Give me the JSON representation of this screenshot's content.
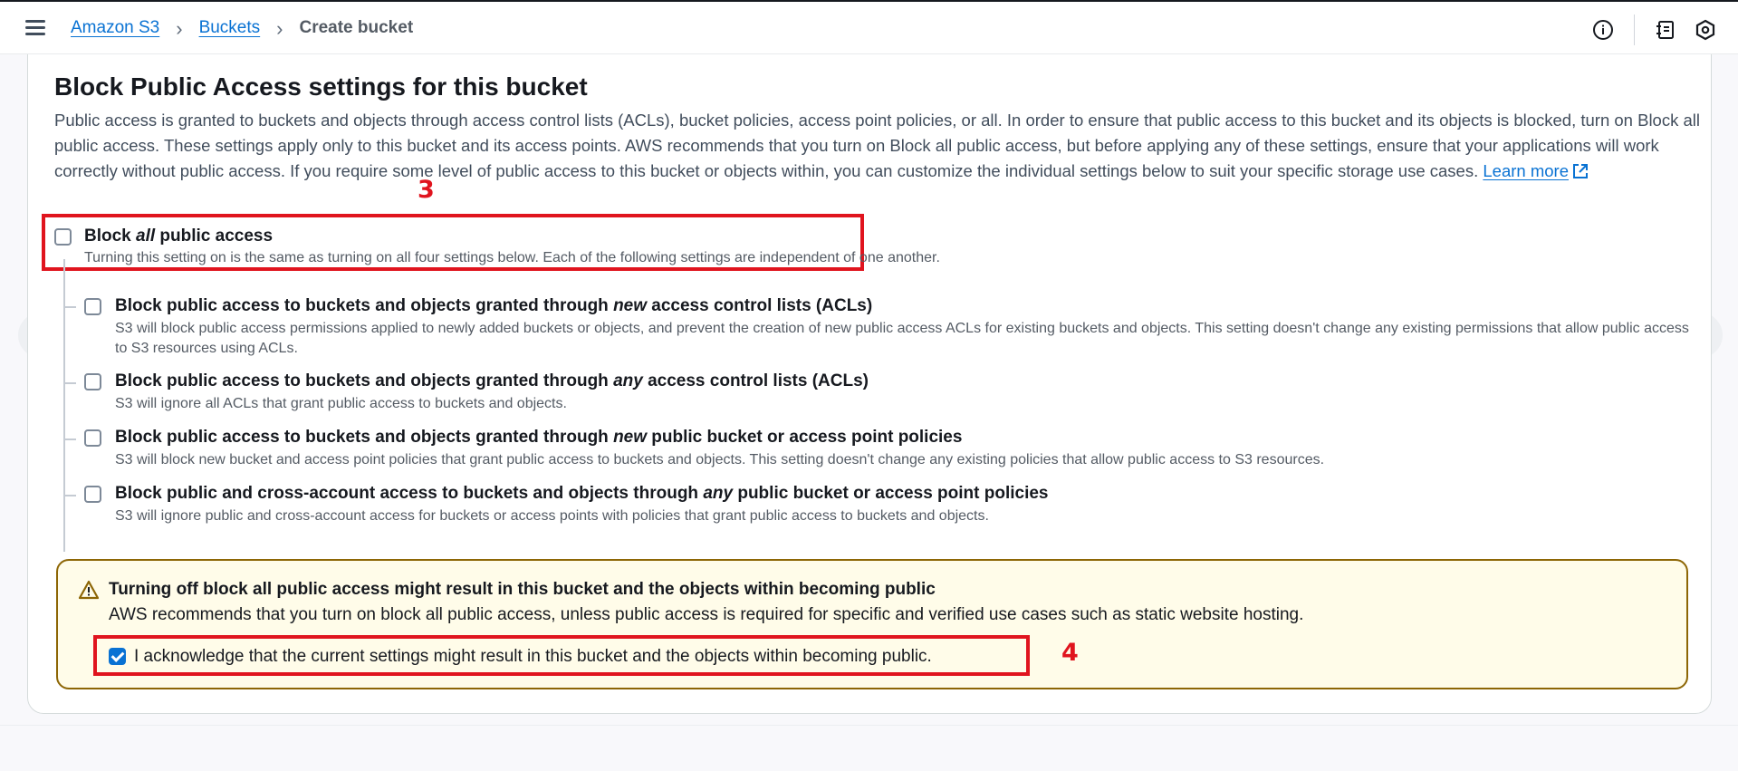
{
  "breadcrumb": {
    "items": [
      {
        "label": "Amazon S3"
      },
      {
        "label": "Buckets"
      }
    ],
    "current": "Create bucket"
  },
  "section": {
    "title": "Block Public Access settings for this bucket",
    "description": "Public access is granted to buckets and objects through access control lists (ACLs), bucket policies, access point policies, or all. In order to ensure that public access to this bucket and its objects is blocked, turn on Block all public access. These settings apply only to this bucket and its access points. AWS recommends that you turn on Block all public access, but before applying any of these settings, ensure that your applications will work correctly without public access. If you require some level of public access to this bucket or objects within, you can customize the individual settings below to suit your specific storage use cases.",
    "learn_more": "Learn more"
  },
  "annotations": {
    "step3": "3",
    "step4": "4"
  },
  "block_all": {
    "label_pre": "Block ",
    "label_em": "all",
    "label_post": " public access",
    "description": "Turning this setting on is the same as turning on all four settings below. Each of the following settings are independent of one another.",
    "checked": false
  },
  "options": [
    {
      "label_pre": "Block public access to buckets and objects granted through ",
      "label_em": "new",
      "label_post": " access control lists (ACLs)",
      "description": "S3 will block public access permissions applied to newly added buckets or objects, and prevent the creation of new public access ACLs for existing buckets and objects. This setting doesn't change any existing permissions that allow public access to S3 resources using ACLs.",
      "checked": false
    },
    {
      "label_pre": "Block public access to buckets and objects granted through ",
      "label_em": "any",
      "label_post": " access control lists (ACLs)",
      "description": "S3 will ignore all ACLs that grant public access to buckets and objects.",
      "checked": false
    },
    {
      "label_pre": "Block public access to buckets and objects granted through ",
      "label_em": "new",
      "label_post": " public bucket or access point policies",
      "description": "S3 will block new bucket and access point policies that grant public access to buckets and objects. This setting doesn't change any existing policies that allow public access to S3 resources.",
      "checked": false
    },
    {
      "label_pre": "Block public and cross-account access to buckets and objects through ",
      "label_em": "any",
      "label_post": " public bucket or access point policies",
      "description": "S3 will ignore public and cross-account access for buckets or access points with policies that grant public access to buckets and objects.",
      "checked": false
    }
  ],
  "warning": {
    "title": "Turning off block all public access might result in this bucket and the objects within becoming public",
    "description": "AWS recommends that you turn on block all public access, unless public access is required for specific and verified use cases such as static website hosting.",
    "acknowledge_label": "I acknowledge that the current settings might result in this bucket and the objects within becoming public.",
    "acknowledge_checked": true
  },
  "icons": {
    "menu": "hamburger-menu-icon",
    "info": "info-icon",
    "notebook": "notebook-icon",
    "settings": "hexagon-settings-icon",
    "prev": "chevron-left-icon",
    "next": "chevron-right-icon",
    "external": "external-link-icon",
    "warning": "warning-triangle-icon"
  },
  "colors": {
    "link": "#0972d3",
    "annotation_red": "#e0141e",
    "warning_bg": "#fffce9",
    "warning_border": "#8d6605",
    "checkbox_checked": "#0972d3"
  }
}
